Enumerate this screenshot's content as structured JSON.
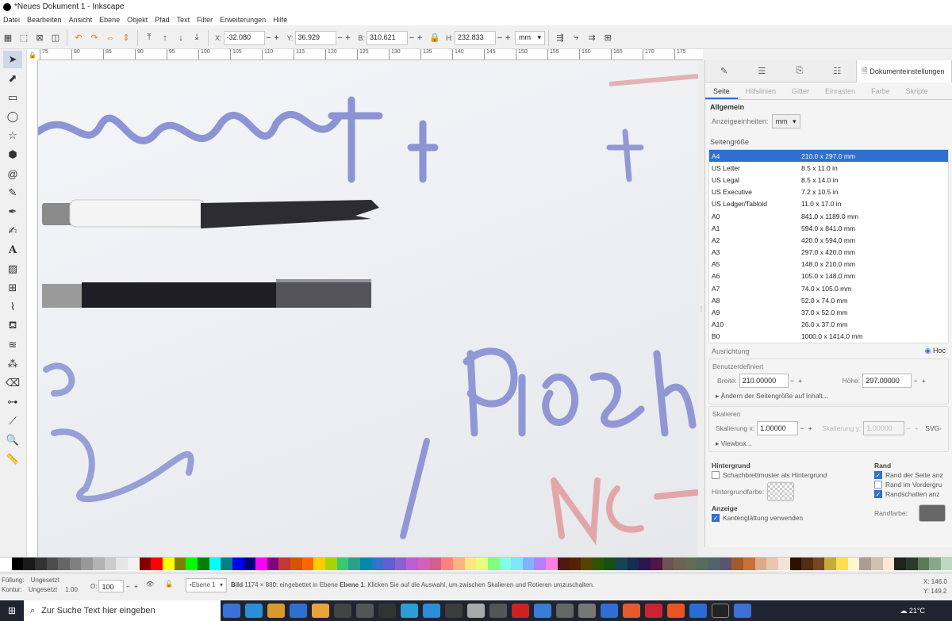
{
  "window": {
    "title": "*Neues Dokument 1 - Inkscape"
  },
  "menu": [
    "Datei",
    "Bearbeiten",
    "Ansicht",
    "Ebene",
    "Objekt",
    "Pfad",
    "Text",
    "Filter",
    "Erweiterungen",
    "Hilfe"
  ],
  "controls": {
    "x_label": "X:",
    "x_value": "-32.080",
    "y_label": "Y:",
    "y_value": "36.929",
    "w_label": "B:",
    "w_value": "310.621",
    "h_label": "H:",
    "h_value": "232.833",
    "unit": "mm"
  },
  "ruler_labels": [
    "75",
    "80",
    "85",
    "90",
    "95",
    "100",
    "105",
    "110",
    "115",
    "120",
    "125",
    "130",
    "135",
    "140",
    "145",
    "150",
    "155",
    "160",
    "165",
    "170",
    "175"
  ],
  "dock": {
    "panel_title": "Dokumenteinstellungen",
    "subtabs": [
      "Seite",
      "Hilfslinien",
      "Gitter",
      "Einrasten",
      "Farbe",
      "Skripte"
    ],
    "general_heading": "Allgemein",
    "display_units_label": "Anzeigeeinheiten:",
    "display_units_value": "mm",
    "page_size_heading": "Seitengröße",
    "page_sizes": [
      {
        "name": "A4",
        "size": "210.0 x 297.0 mm"
      },
      {
        "name": "US Letter",
        "size": "8.5 x 11.0 in"
      },
      {
        "name": "US Legal",
        "size": "8.5 x 14.0 in"
      },
      {
        "name": "US Executive",
        "size": "7.2 x 10.5 in"
      },
      {
        "name": "US Ledger/Tabloid",
        "size": "11.0 x 17.0 in"
      },
      {
        "name": "A0",
        "size": "841.0 x 1189.0 mm"
      },
      {
        "name": "A1",
        "size": "594.0 x 841.0 mm"
      },
      {
        "name": "A2",
        "size": "420.0 x 594.0 mm"
      },
      {
        "name": "A3",
        "size": "297.0 x 420.0 mm"
      },
      {
        "name": "A5",
        "size": "148.0 x 210.0 mm"
      },
      {
        "name": "A6",
        "size": "105.0 x 148.0 mm"
      },
      {
        "name": "A7",
        "size": "74.0 x 105.0 mm"
      },
      {
        "name": "A8",
        "size": "52.0 x 74.0 mm"
      },
      {
        "name": "A9",
        "size": "37.0 x 52.0 mm"
      },
      {
        "name": "A10",
        "size": "26.0 x 37.0 mm"
      },
      {
        "name": "B0",
        "size": "1000.0 x 1414.0 mm"
      }
    ],
    "orientation_label": "Ausrichtung",
    "orientation_option": "Hoc",
    "custom_heading": "Benutzerdefiniert",
    "width_label": "Breite:",
    "width_value": "210.00000",
    "height_label": "Höhe:",
    "height_value": "297.00000",
    "resize_expander": "Ändern der Seitengröße auf Inhalt...",
    "scale_heading": "Skalieren",
    "scale_x_label": "Skalierung x:",
    "scale_x_value": "1.00000",
    "scale_y_label": "Skalierung y:",
    "scale_y_value": "1.00000",
    "svg_label": "SVG-",
    "viewbox_expander": "Viewbox...",
    "background_heading": "Hintergrund",
    "checkerboard_label": "Schachbrettmuster als Hintergrund",
    "bg_color_label": "Hintergrundfarbe:",
    "border_heading": "Rand",
    "border_checks": [
      {
        "label": "Rand der Seite anz",
        "checked": true
      },
      {
        "label": "Rand im Vordergru",
        "checked": false
      },
      {
        "label": "Randschatten anz",
        "checked": true
      }
    ],
    "border_color_label": "Randfarbe:",
    "display_heading": "Anzeige",
    "antialias_label": "Kantenglättung verwenden"
  },
  "status": {
    "fill_label": "Füllung:",
    "fill_value": "Ungesetzt",
    "stroke_label": "Kontur:",
    "stroke_value": "Ungesetzt",
    "stroke_width": "1.00",
    "opacity_label": "O:",
    "opacity_value": "100",
    "layer": "•Ebene 1",
    "message_bold": "Bild",
    "message": "1174 × 880: eingebettet in Ebene",
    "message_layer": "Ebene 1",
    "message_tail": ". Klicken Sie auf die Auswahl, um zwischen Skalieren und Rotieren umzuschalten.",
    "coord_x_label": "X:",
    "coord_x": "146.0",
    "coord_y_label": "Y:",
    "coord_y": "149.2"
  },
  "taskbar": {
    "search_placeholder": "Zur Suche Text hier eingeben",
    "weather": "21°C"
  }
}
